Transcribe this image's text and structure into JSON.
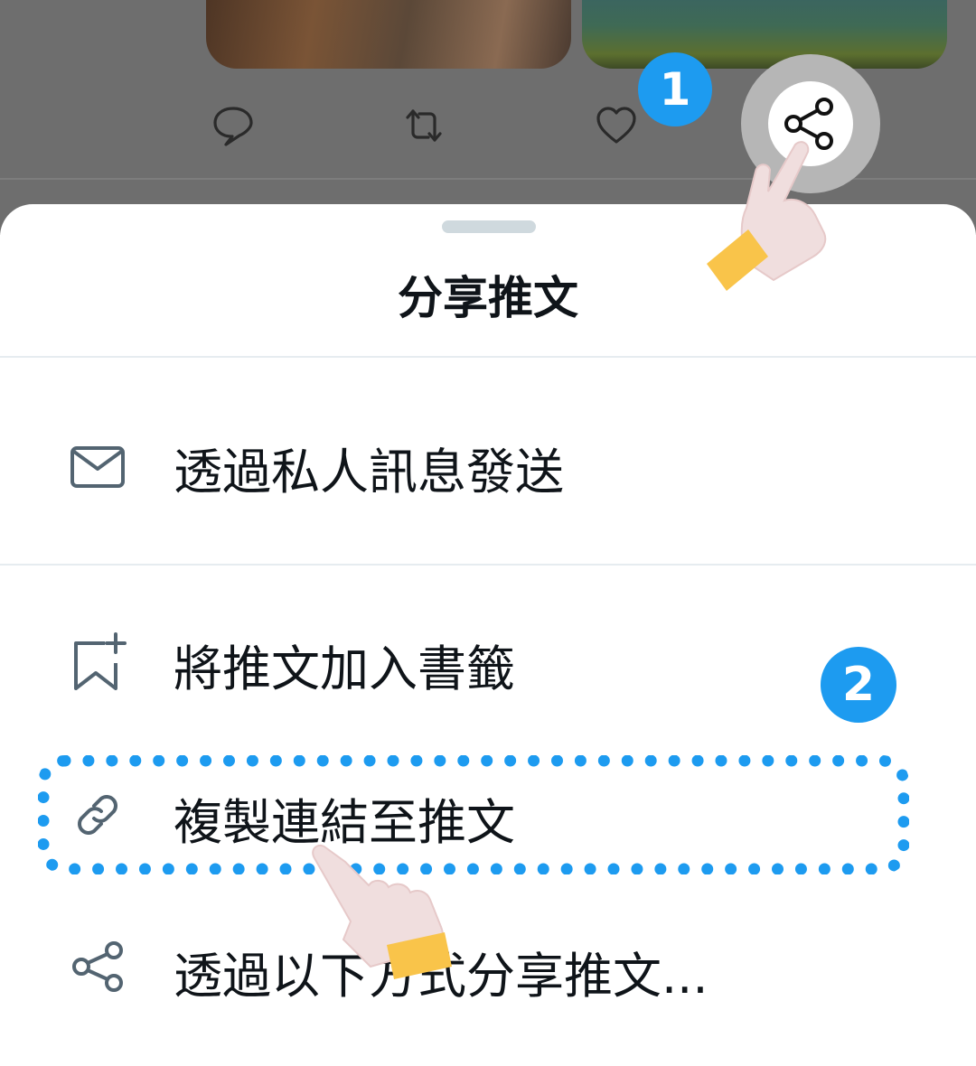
{
  "sheet": {
    "title": "分享推文",
    "items": [
      {
        "id": "dm",
        "label": "透過私人訊息發送",
        "icon": "envelope-icon"
      },
      {
        "id": "bookmark",
        "label": "將推文加入書籤",
        "icon": "bookmark-add-icon"
      },
      {
        "id": "copy_link",
        "label": "複製連結至推文",
        "icon": "link-icon"
      },
      {
        "id": "share_via",
        "label": "透過以下方式分享推文...",
        "icon": "share-icon"
      }
    ]
  },
  "tweet_actions": {
    "icons": [
      "reply-icon",
      "retweet-icon",
      "like-icon",
      "share-icon"
    ]
  },
  "annotations": {
    "step_1": "1",
    "step_2": "2",
    "accent_color": "#1d9bf0",
    "hand_cuff_color": "#f9c44a"
  }
}
